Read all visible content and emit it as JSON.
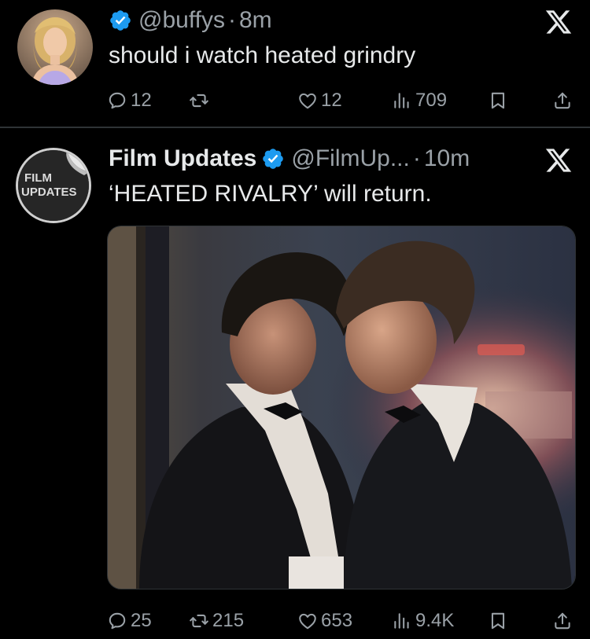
{
  "tweets": [
    {
      "handle": "@buffys",
      "dot": "·",
      "time": "8m",
      "text": "should i watch heated grindry",
      "stats": {
        "replies": "12",
        "retweets": "",
        "likes": "12",
        "views": "709"
      }
    },
    {
      "name": "Film Updates",
      "handle": "@FilmUp...",
      "dot": "·",
      "time": "10m",
      "text": "‘HEATED RIVALRY’ will return.",
      "avatar_text": [
        "FILM",
        "UPDATES"
      ],
      "stats": {
        "replies": "25",
        "retweets": "215",
        "likes": "653",
        "views": "9.4K"
      }
    }
  ],
  "icons": [
    "verified-badge-icon",
    "x-logo-icon",
    "reply-icon",
    "retweet-icon",
    "like-icon",
    "views-icon",
    "bookmark-icon",
    "share-icon"
  ],
  "colors": {
    "background": "#000000",
    "text": "#e7e9ea",
    "muted": "#9aa1a7",
    "verified": "#1d9bf0",
    "divider": "#2f3336"
  }
}
